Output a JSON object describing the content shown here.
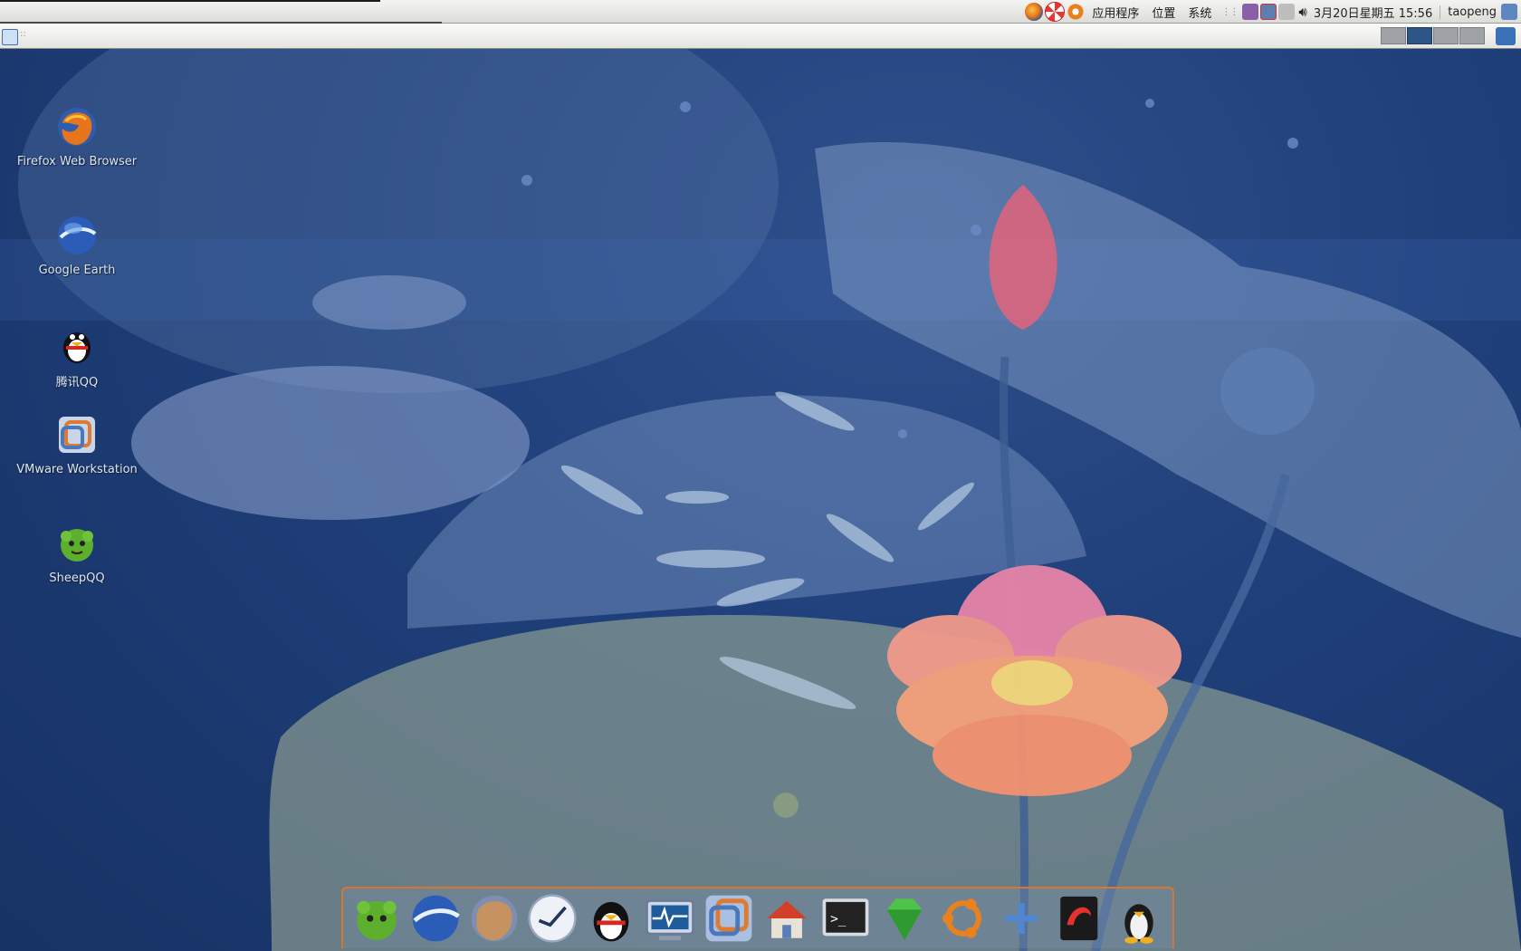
{
  "top_panel": {
    "menus": [
      "应用程序",
      "位置",
      "系统"
    ],
    "clock": "3月20日星期五 15:56",
    "user": "taopeng",
    "launchers": [
      "firefox-icon",
      "help-lifebuoy-icon",
      "ubuntu-logo-icon"
    ],
    "tray": [
      "preferences-icon",
      "network-icon",
      "printer-icon",
      "volume-icon"
    ]
  },
  "workspaces": {
    "count": 4,
    "active_index": 1
  },
  "desktop_icons": [
    {
      "label": "Firefox Web Browser",
      "icon": "firefox-icon"
    },
    {
      "label": "Google Earth",
      "icon": "google-earth-icon"
    },
    {
      "label": "腾讯QQ",
      "icon": "qq-penguin-icon"
    },
    {
      "label": "VMware Workstation",
      "icon": "vmware-icon"
    },
    {
      "label": "SheepQQ",
      "icon": "sheepqq-icon"
    }
  ],
  "dock_items": [
    "sheepqq-icon",
    "google-earth-icon",
    "firefox-icon",
    "clock-icon",
    "qq-penguin-icon",
    "system-monitor-icon",
    "vmware-icon",
    "home-folder-icon",
    "terminal-icon",
    "ruby-gem-icon",
    "ubuntu-logo-icon",
    "add-plus-icon",
    "stardict-icon",
    "tux-penguin-icon"
  ],
  "colors": {
    "dock_border": "#d7762f",
    "panel_bg": "#e8e8e4",
    "active_workspace": "#2d5688"
  }
}
